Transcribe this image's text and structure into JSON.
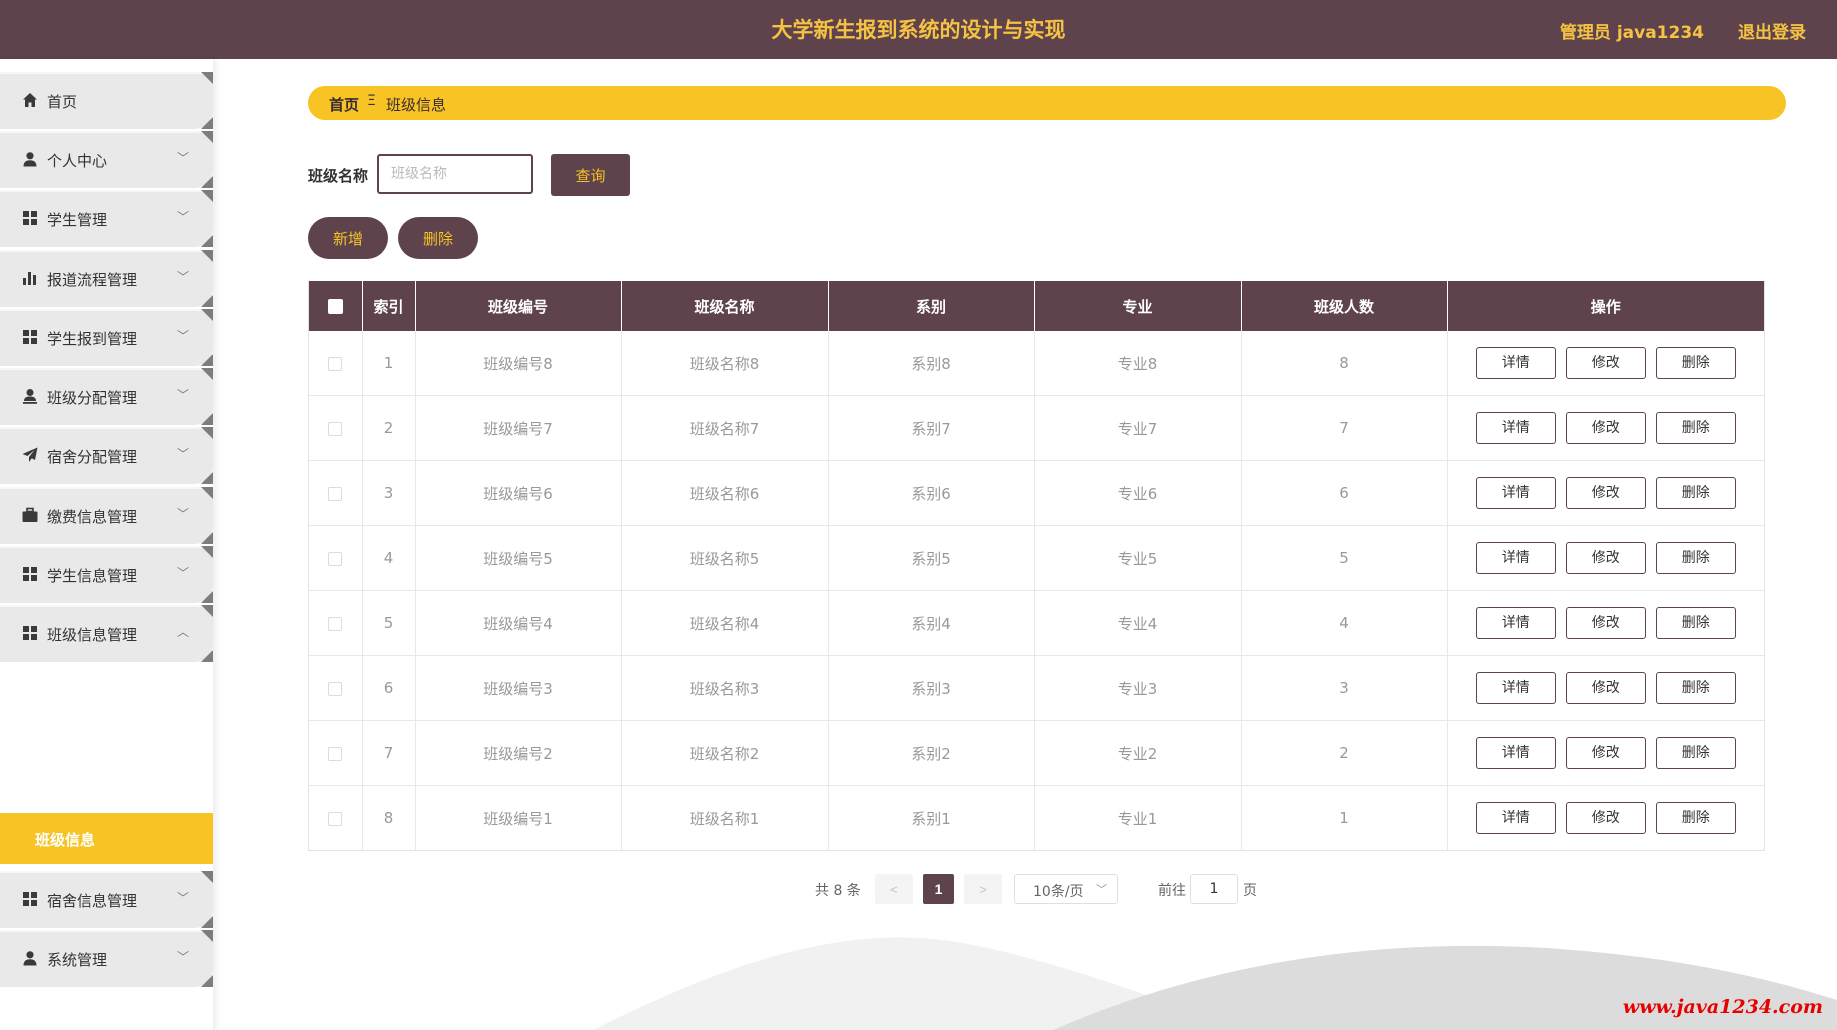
{
  "header": {
    "title": "大学新生报到系统的设计与实现",
    "user": "管理员 java1234",
    "logout": "退出登录"
  },
  "sidebar": {
    "items": [
      {
        "label": "首页",
        "icon": "home-icon"
      },
      {
        "label": "个人中心",
        "icon": "user-icon"
      },
      {
        "label": "学生管理",
        "icon": "grid-icon"
      },
      {
        "label": "报道流程管理",
        "icon": "bar-chart-icon"
      },
      {
        "label": "学生报到管理",
        "icon": "grid-icon"
      },
      {
        "label": "班级分配管理",
        "icon": "user-upload-icon"
      },
      {
        "label": "宿舍分配管理",
        "icon": "paper-plane-icon"
      },
      {
        "label": "缴费信息管理",
        "icon": "briefcase-icon"
      },
      {
        "label": "学生信息管理",
        "icon": "grid-icon"
      },
      {
        "label": "班级信息管理",
        "icon": "grid-icon"
      },
      {
        "label": "宿舍信息管理",
        "icon": "grid-icon"
      },
      {
        "label": "系统管理",
        "icon": "user-icon"
      }
    ],
    "submenu": {
      "label": "班级信息"
    },
    "arrow_down": "﹀",
    "arrow_up": "︿"
  },
  "breadcrumb": {
    "home": "首页",
    "separator": "Ξ",
    "current": "班级信息"
  },
  "search": {
    "label": "班级名称",
    "placeholder": "班级名称",
    "value": "",
    "query_label": "查询"
  },
  "actions": {
    "add_label": "新增",
    "delete_label": "删除"
  },
  "table": {
    "columns": [
      "",
      "索引",
      "班级编号",
      "班级名称",
      "系别",
      "专业",
      "班级人数",
      "操作"
    ],
    "rows": [
      {
        "index": "1",
        "code": "班级编号8",
        "name": "班级名称8",
        "dept": "系别8",
        "major": "专业8",
        "count": "8"
      },
      {
        "index": "2",
        "code": "班级编号7",
        "name": "班级名称7",
        "dept": "系别7",
        "major": "专业7",
        "count": "7"
      },
      {
        "index": "3",
        "code": "班级编号6",
        "name": "班级名称6",
        "dept": "系别6",
        "major": "专业6",
        "count": "6"
      },
      {
        "index": "4",
        "code": "班级编号5",
        "name": "班级名称5",
        "dept": "系别5",
        "major": "专业5",
        "count": "5"
      },
      {
        "index": "5",
        "code": "班级编号4",
        "name": "班级名称4",
        "dept": "系别4",
        "major": "专业4",
        "count": "4"
      },
      {
        "index": "6",
        "code": "班级编号3",
        "name": "班级名称3",
        "dept": "系别3",
        "major": "专业3",
        "count": "3"
      },
      {
        "index": "7",
        "code": "班级编号2",
        "name": "班级名称2",
        "dept": "系别2",
        "major": "专业2",
        "count": "2"
      },
      {
        "index": "8",
        "code": "班级编号1",
        "name": "班级名称1",
        "dept": "系别1",
        "major": "专业1",
        "count": "1"
      }
    ],
    "ops": {
      "detail": "详情",
      "edit": "修改",
      "delete": "删除"
    }
  },
  "pagination": {
    "total": "共 8 条",
    "prev": "<",
    "next": ">",
    "current_page": "1",
    "page_size": "10条/页",
    "goto_label": "前往",
    "goto_value": "1",
    "page_unit": "页"
  },
  "watermark": "www.java1234.com",
  "colors": {
    "primary": "#5e434d",
    "accent": "#f7c325",
    "watermark": "#e60000"
  }
}
